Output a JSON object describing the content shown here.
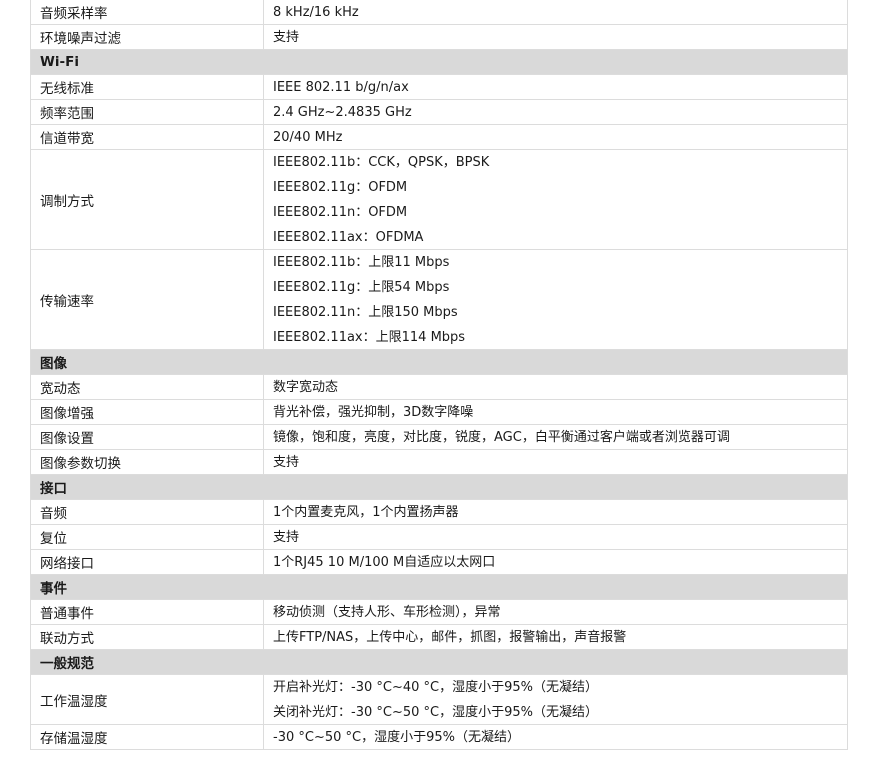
{
  "rows": [
    {
      "type": "item",
      "label": "音频采样率",
      "values": [
        "8 kHz/16 kHz"
      ]
    },
    {
      "type": "item",
      "label": "环境噪声过滤",
      "values": [
        "支持"
      ]
    },
    {
      "type": "section",
      "label": "Wi-Fi"
    },
    {
      "type": "item",
      "label": "无线标准",
      "values": [
        "IEEE 802.11 b/g/n/ax"
      ]
    },
    {
      "type": "item",
      "label": "频率范围",
      "values": [
        "2.4 GHz~2.4835 GHz"
      ]
    },
    {
      "type": "item",
      "label": "信道带宽",
      "values": [
        "20/40 MHz"
      ]
    },
    {
      "type": "item",
      "label": "调制方式",
      "values": [
        "IEEE802.11b：CCK，QPSK，BPSK",
        "IEEE802.11g：OFDM",
        "IEEE802.11n：OFDM",
        "IEEE802.11ax：OFDMA"
      ]
    },
    {
      "type": "item",
      "label": "传输速率",
      "values": [
        "IEEE802.11b：上限11 Mbps",
        "IEEE802.11g：上限54 Mbps",
        "IEEE802.11n：上限150 Mbps",
        "IEEE802.11ax：上限114 Mbps"
      ]
    },
    {
      "type": "section",
      "label": "图像"
    },
    {
      "type": "item",
      "label": "宽动态",
      "values": [
        "数字宽动态"
      ]
    },
    {
      "type": "item",
      "label": "图像增强",
      "values": [
        "背光补偿，强光抑制，3D数字降噪"
      ]
    },
    {
      "type": "item",
      "label": "图像设置",
      "values": [
        "镜像，饱和度，亮度，对比度，锐度，AGC，白平衡通过客户端或者浏览器可调"
      ]
    },
    {
      "type": "item",
      "label": "图像参数切换",
      "values": [
        "支持"
      ]
    },
    {
      "type": "section",
      "label": "接口"
    },
    {
      "type": "item",
      "label": "音频",
      "values": [
        "1个内置麦克风，1个内置扬声器"
      ]
    },
    {
      "type": "item",
      "label": "复位",
      "values": [
        "支持"
      ]
    },
    {
      "type": "item",
      "label": "网络接口",
      "values": [
        "1个RJ45 10 M/100 M自适应以太网口"
      ]
    },
    {
      "type": "section",
      "label": "事件"
    },
    {
      "type": "item",
      "label": "普通事件",
      "values": [
        "移动侦测（支持人形、车形检测），异常"
      ]
    },
    {
      "type": "item",
      "label": "联动方式",
      "values": [
        "上传FTP/NAS，上传中心，邮件，抓图，报警输出，声音报警"
      ]
    },
    {
      "type": "section",
      "label": "一般规范"
    },
    {
      "type": "item",
      "label": "工作温湿度",
      "values": [
        "开启补光灯：-30 °C~40 °C，湿度小于95%（无凝结）",
        "关闭补光灯：-30 °C~50 °C，湿度小于95%（无凝结）"
      ]
    },
    {
      "type": "item",
      "label": "存储温湿度",
      "values": [
        "-30 °C~50 °C，湿度小于95%（无凝结）"
      ]
    }
  ]
}
